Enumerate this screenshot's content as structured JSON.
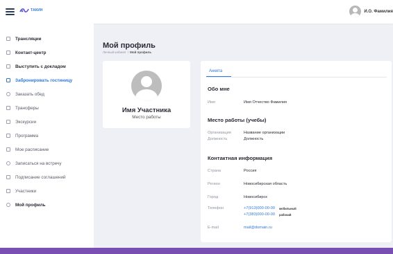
{
  "header": {
    "logo_text": "ТАКИН",
    "user_name": "И.О. Фамилия"
  },
  "sidebar": {
    "items": [
      {
        "label": "Трансляции",
        "icon": "play-screen-icon"
      },
      {
        "label": "Контакт-центр",
        "icon": "chat-icon"
      },
      {
        "label": "Выступить с докладом",
        "icon": "presentation-icon"
      },
      {
        "label": "Забронировать гостиницу",
        "icon": "bed-icon"
      },
      {
        "label": "Заказать обед",
        "icon": "food-icon"
      },
      {
        "label": "Трансферы",
        "icon": "bus-icon"
      },
      {
        "label": "Экскурсии",
        "icon": "camera-icon"
      },
      {
        "label": "Программа",
        "icon": "calendar-icon"
      },
      {
        "label": "Мое расписание",
        "icon": "schedule-icon"
      },
      {
        "label": "Записаться на встречу",
        "icon": "handshake-icon"
      },
      {
        "label": "Подписание соглашений",
        "icon": "pen-icon"
      },
      {
        "label": "Участники",
        "icon": "people-icon"
      },
      {
        "label": "Мой профиль",
        "icon": "user-icon"
      }
    ]
  },
  "main": {
    "title": "Мой профиль",
    "breadcrumb": {
      "parent": "Личный кабинет",
      "sep": "/",
      "current": "Мой профиль"
    }
  },
  "profile": {
    "name": "Имя Участника",
    "workplace": "Место работы"
  },
  "info": {
    "tab": "Анкета",
    "about": {
      "title": "Обо мне",
      "name_label": "Имя",
      "name_value": "Имя Отчество Фамилия"
    },
    "work": {
      "title": "Место работы (учебы)",
      "org_label": "Организация",
      "org_value": "Название организации",
      "pos_label": "Должность",
      "pos_value": "Должность"
    },
    "contact": {
      "title": "Контактная информация",
      "country_label": "Страна",
      "country_value": "Россия",
      "region_label": "Регион",
      "region_value": "Новосибирская область",
      "city_label": "Город",
      "city_value": "Новосибирск",
      "phone_label": "Телефон",
      "phone_mobile": "+7(913)000-00-00",
      "phone_mobile_tag": "мобильный",
      "phone_work": "+7(383)000-00-00",
      "phone_work_tag": "рабочий",
      "email_label": "E-mail",
      "email_value": "mail@domain.ru"
    }
  },
  "colors": {
    "accent": "#2e78d6",
    "background": "#eef0f5",
    "frame": "#7a4fb3"
  }
}
